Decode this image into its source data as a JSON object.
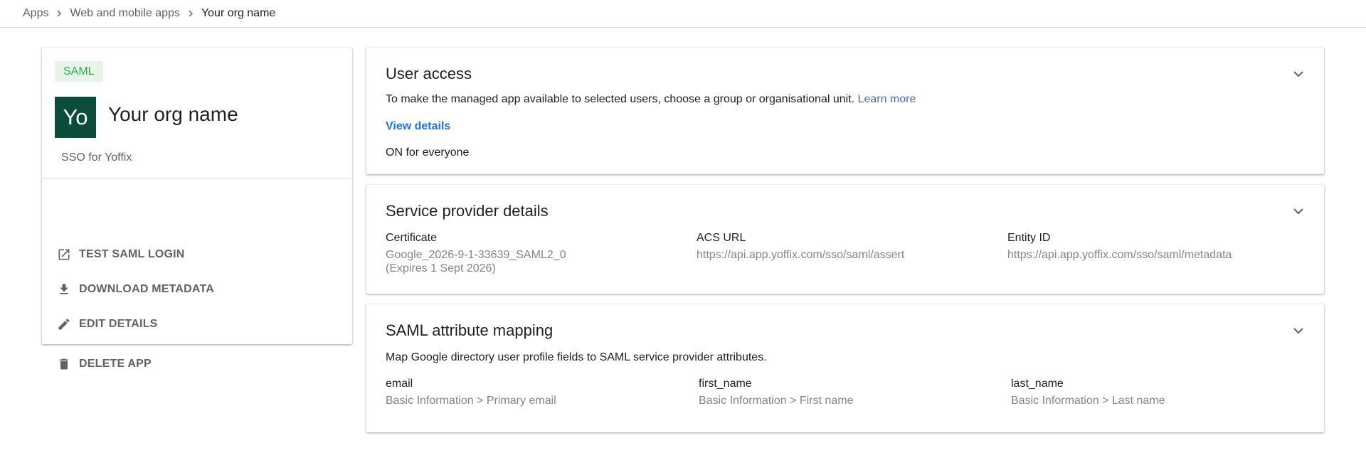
{
  "breadcrumb": {
    "items": [
      "Apps",
      "Web and mobile apps"
    ],
    "current": "Your org name"
  },
  "app": {
    "badge": "SAML",
    "avatar_text": "Yo",
    "avatar_color": "#0b4c3b",
    "name": "Your org name",
    "description": "SSO for Yoffix"
  },
  "actions": [
    {
      "label": "TEST SAML LOGIN",
      "icon": "open-in-new-icon"
    },
    {
      "label": "DOWNLOAD METADATA",
      "icon": "download-icon"
    },
    {
      "label": "EDIT DETAILS",
      "icon": "edit-pencil-icon"
    },
    {
      "label": "DELETE APP",
      "icon": "trash-icon"
    }
  ],
  "user_access": {
    "title": "User access",
    "description": "To make the managed app available to selected users, choose a group or organisational unit.",
    "learn_more": "Learn more",
    "view_details": "View details",
    "status": "ON for everyone"
  },
  "service_provider": {
    "title": "Service provider details",
    "certificate_label": "Certificate",
    "certificate_value": "Google_2026-9-1-33639_SAML2_0",
    "certificate_expiry": "(Expires 1 Sept 2026)",
    "acs_label": "ACS URL",
    "acs_value": "https://api.app.yoffix.com/sso/saml/assert",
    "entity_label": "Entity ID",
    "entity_value": "https://api.app.yoffix.com/sso/saml/metadata"
  },
  "attribute_mapping": {
    "title": "SAML attribute mapping",
    "description": "Map Google directory user profile fields to SAML service provider attributes.",
    "mappings": [
      {
        "attribute": "email",
        "source": "Basic Information > Primary email"
      },
      {
        "attribute": "first_name",
        "source": "Basic Information > First name"
      },
      {
        "attribute": "last_name",
        "source": "Basic Information > Last name"
      }
    ]
  },
  "colors": {
    "link": "#1a73e8",
    "badge_bg": "#e6f4ea",
    "badge_text": "#34a853"
  }
}
